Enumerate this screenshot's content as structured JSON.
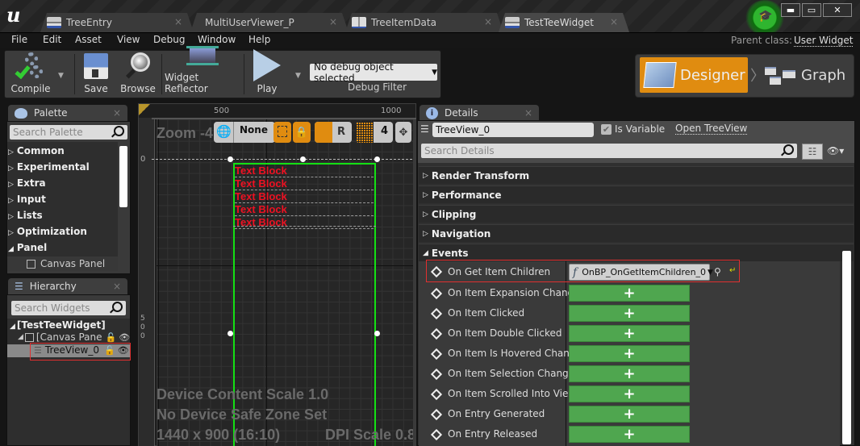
{
  "window": {
    "tabs": [
      {
        "label": "TreeEntry",
        "icon": "widget-blueprint-icon"
      },
      {
        "label": "MultiUserViewer_P",
        "icon": ""
      },
      {
        "label": "TreeItemData",
        "icon": "book-icon"
      },
      {
        "label": "TestTeeWidget",
        "icon": "widget-blueprint-icon",
        "active": true
      }
    ],
    "close_glyph": "×",
    "controls": {
      "minimize": "▬",
      "maximize": "▭",
      "close": "✕"
    }
  },
  "menu": [
    "File",
    "Edit",
    "Asset",
    "View",
    "Debug",
    "Window",
    "Help"
  ],
  "parent_class": {
    "label": "Parent class:",
    "value": "User Widget"
  },
  "toolbar": {
    "compile": "Compile",
    "save": "Save",
    "browse": "Browse",
    "widget_reflector": "Widget Reflector",
    "play": "Play",
    "debug_select": "No debug object selected",
    "debug_filter": "Debug Filter"
  },
  "modes": {
    "designer": "Designer",
    "graph": "Graph",
    "separator": "〉"
  },
  "palette": {
    "title": "Palette",
    "search_placeholder": "Search Palette",
    "categories": [
      "Common",
      "Experimental",
      "Extra",
      "Input",
      "Lists",
      "Optimization",
      "Panel"
    ],
    "expanded_child": "Canvas Panel"
  },
  "hierarchy": {
    "title": "Hierarchy",
    "search_placeholder": "Search Widgets",
    "root": "[TestTeeWidget]",
    "canvas": "[Canvas Pane",
    "selected": "TreeView_0"
  },
  "canvas": {
    "ruler_top": [
      "500",
      "1000"
    ],
    "ruler_left_zero": "0",
    "ruler_left_500": [
      "5",
      "0",
      "0"
    ],
    "zoom_label": "Zoom -4",
    "locale_value": "None",
    "r_label": "R",
    "grid_value": "4",
    "text_blocks": [
      "Text Block",
      "Text Block",
      "Text Block",
      "Text Block",
      "Text Block"
    ],
    "info": [
      "Device Content Scale 1.0",
      "No Device Safe Zone Set",
      "1440 x 900 (16:10)"
    ],
    "dpi": "DPI Scale 0.8"
  },
  "details": {
    "title": "Details",
    "name_value": "TreeView_0",
    "is_variable_label": "Is Variable",
    "is_variable_checked": true,
    "open_link": "Open TreeView",
    "search_placeholder": "Search Details",
    "sections": [
      "Render Transform",
      "Performance",
      "Clipping",
      "Navigation"
    ],
    "events_title": "Events",
    "bound_event": {
      "label": "On Get Item Children",
      "function": "OnBP_OnGetItemChildren_0"
    },
    "events": [
      "On Item Expansion Changed",
      "On Item Clicked",
      "On Item Double Clicked",
      "On Item Is Hovered Changed",
      "On Item Selection Changed",
      "On Item Scrolled Into View",
      "On Entry Generated",
      "On Entry Released"
    ],
    "add_glyph": "+"
  },
  "colors": {
    "accent": "#e08c10",
    "selection_green": "#00ff00",
    "event_add": "#4fa64f",
    "highlight_red": "#e03030",
    "text_block": "#ee1122"
  }
}
